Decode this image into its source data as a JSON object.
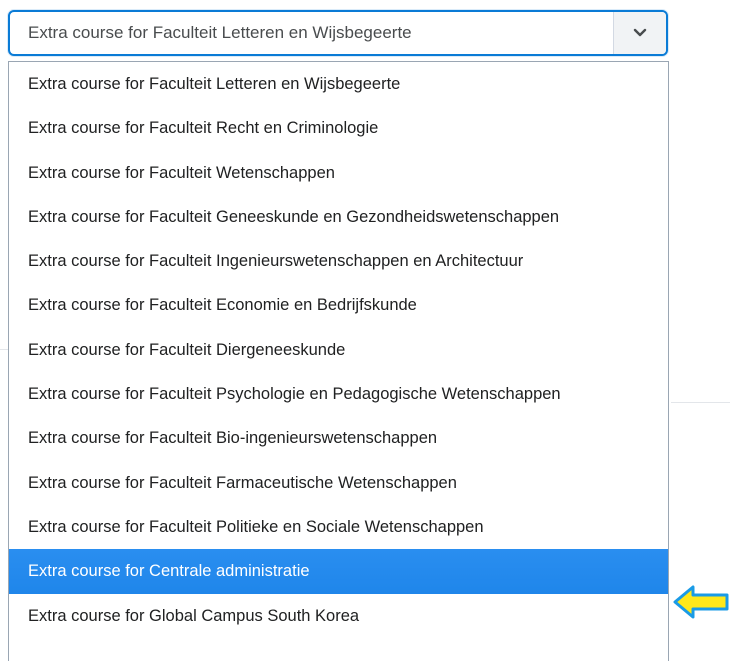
{
  "select": {
    "value": "Extra course for Faculteit Letteren en Wijsbegeerte",
    "toggle_icon": "chevron-down-icon"
  },
  "options": [
    "Extra course for Faculteit Letteren en Wijsbegeerte",
    "Extra course for Faculteit Recht en Criminologie",
    "Extra course for Faculteit Wetenschappen",
    "Extra course for Faculteit Geneeskunde en Gezondheidswetenschappen",
    "Extra course for Faculteit Ingenieurswetenschappen en Architectuur",
    "Extra course for Faculteit Economie en Bedrijfskunde",
    "Extra course for Faculteit Diergeneeskunde",
    "Extra course for Faculteit Psychologie en Pedagogische Wetenschappen",
    "Extra course for Faculteit Bio-ingenieurswetenschappen",
    "Extra course for Faculteit Farmaceutische Wetenschappen",
    "Extra course for Faculteit Politieke en Sociale Wetenschappen",
    "Extra course for Centrale administratie",
    "Extra course for Global Campus South Korea"
  ],
  "highlighted_option": "Extra course for Centrale administratie",
  "annotation": {
    "icon": "left-arrow-icon",
    "fill_color": "#ffe81a",
    "outline_color": "#1a9be6"
  },
  "colors": {
    "focus_border": "#0a7bd6",
    "highlight": "#1f86ea"
  }
}
